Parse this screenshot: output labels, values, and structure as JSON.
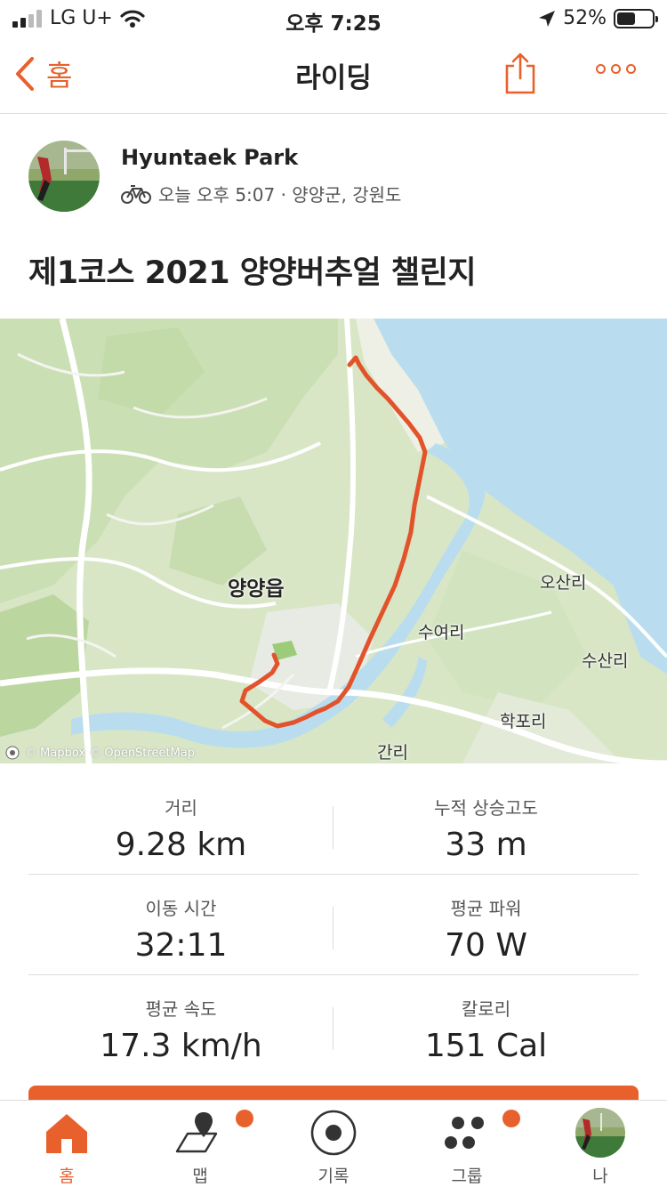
{
  "status_bar": {
    "carrier": "LG U+",
    "time": "오후 7:25",
    "battery_percent": "52%",
    "battery_level": 0.52
  },
  "nav": {
    "back_label": "홈",
    "title": "라이딩"
  },
  "activity": {
    "athlete_name": "Hyuntaek Park",
    "meta": "오늘 오후 5:07 · 양양군, 강원도",
    "title": "제1코스 2021 양양버추얼 챌린지"
  },
  "map": {
    "labels": {
      "town": "양양읍",
      "osan": "오산리",
      "suyeo": "수여리",
      "susan": "수산리",
      "hakpo": "학포리",
      "gan": "간리"
    },
    "attribution": "© Mapbox © OpenStreetMap",
    "route_color": "#e2532b",
    "sea_color": "#b9ddef"
  },
  "stats": [
    {
      "left": {
        "label": "거리",
        "value": "9.28 km"
      },
      "right": {
        "label": "누적 상승고도",
        "value": "33 m"
      }
    },
    {
      "left": {
        "label": "이동 시간",
        "value": "32:11"
      },
      "right": {
        "label": "평균 파워",
        "value": "70 W"
      }
    },
    {
      "left": {
        "label": "평균 속도",
        "value": "17.3 km/h"
      },
      "right": {
        "label": "칼로리",
        "value": "151 Cal"
      }
    }
  ],
  "tabs": [
    {
      "label": "홈",
      "icon": "home-icon",
      "active": true
    },
    {
      "label": "맵",
      "icon": "map-icon",
      "badge": true
    },
    {
      "label": "기록",
      "icon": "record-icon"
    },
    {
      "label": "그룹",
      "icon": "groups-icon",
      "badge": true
    },
    {
      "label": "나",
      "icon": "avatar"
    }
  ],
  "colors": {
    "accent": "#e8612c"
  }
}
